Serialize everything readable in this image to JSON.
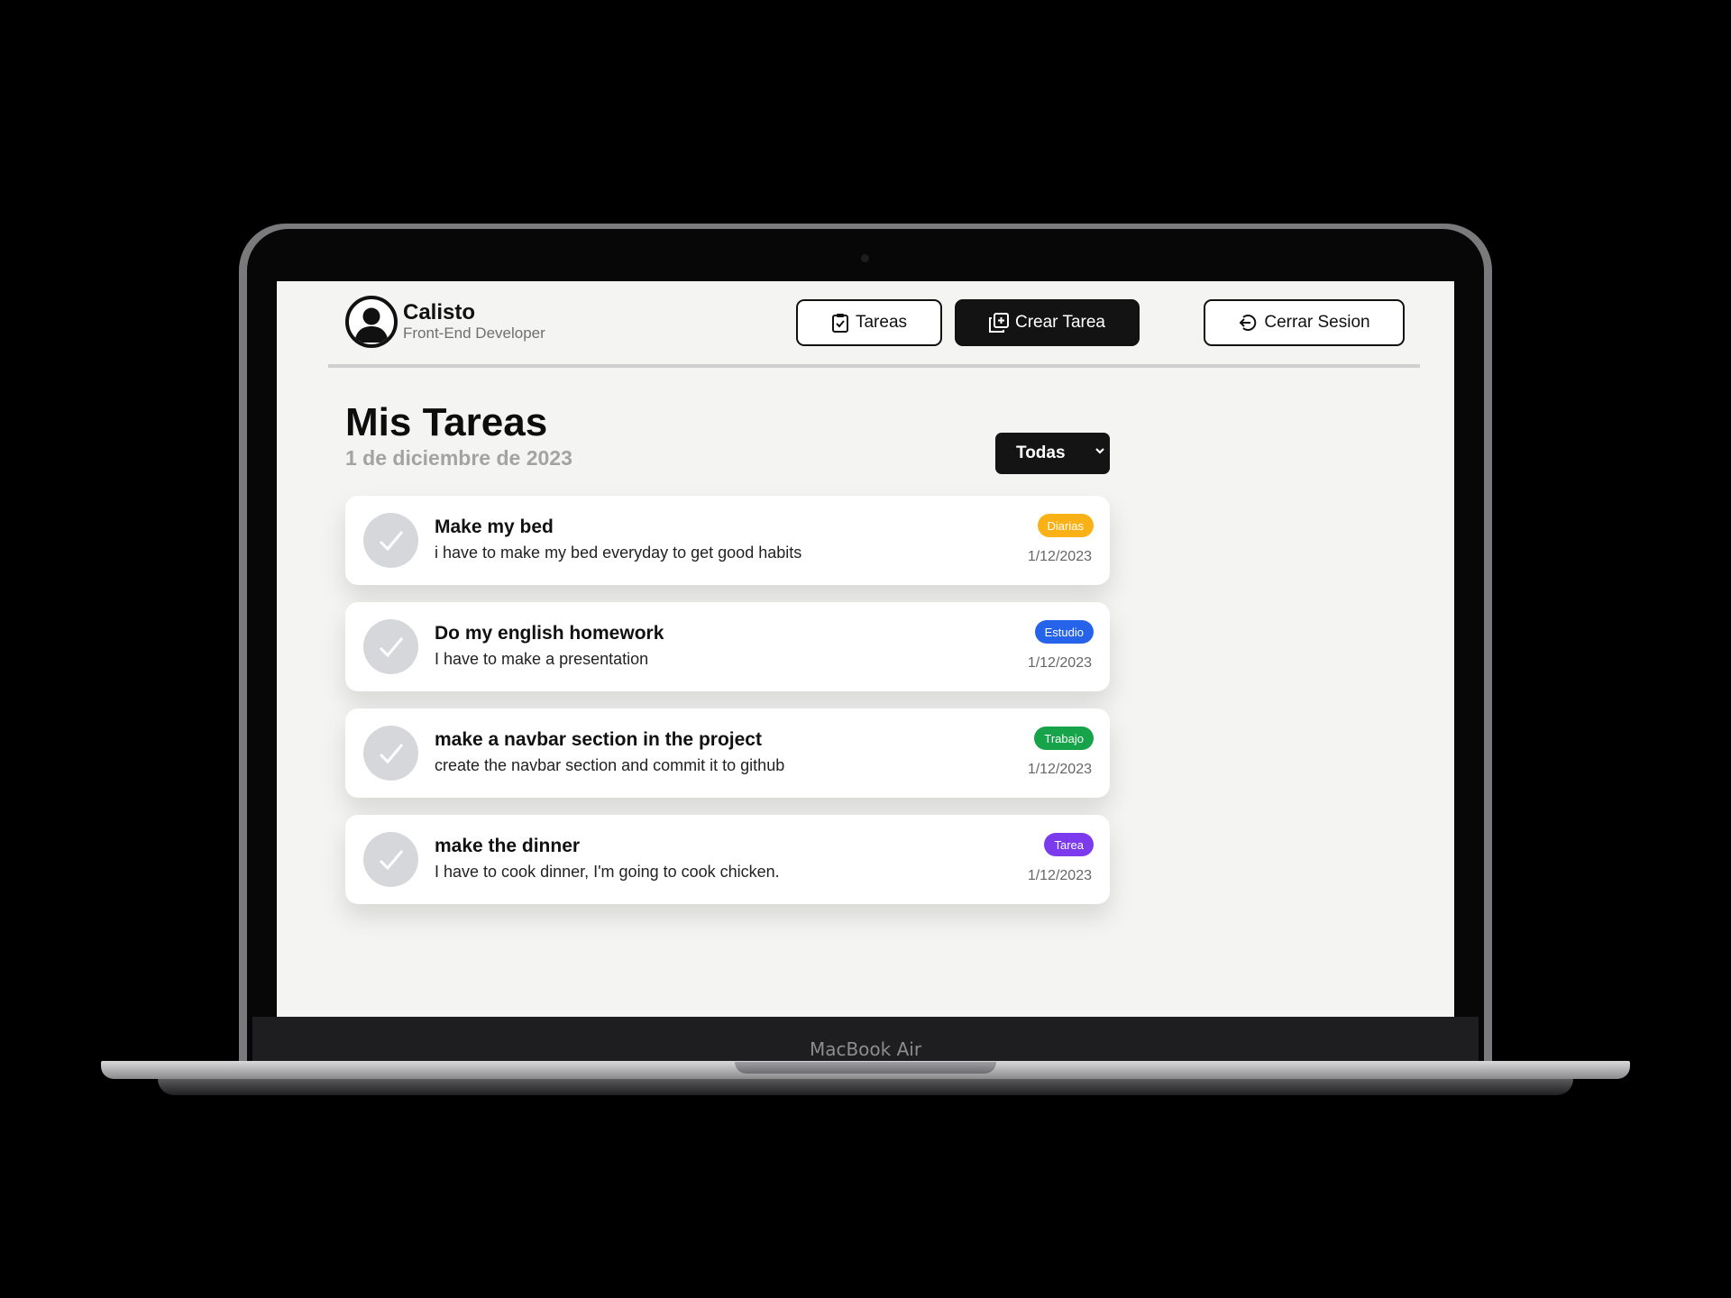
{
  "device": {
    "label": "MacBook Air"
  },
  "user": {
    "name": "Calisto",
    "role": "Front-End Developer"
  },
  "nav": {
    "tasks_label": "Tareas",
    "create_label": "Crear Tarea",
    "logout_label": "Cerrar Sesion"
  },
  "page": {
    "title": "Mis Tareas",
    "date": "1 de diciembre de 2023",
    "filter": {
      "selected": "Todas"
    }
  },
  "tasks": [
    {
      "title": "Make my bed",
      "description": "i have to make my bed everyday to get good habits",
      "category": "Diarias",
      "category_color": "#f9b116",
      "date": "1/12/2023"
    },
    {
      "title": "Do my english homework",
      "description": "I have to make a presentation",
      "category": "Estudio",
      "category_color": "#2563eb",
      "date": "1/12/2023"
    },
    {
      "title": "make a navbar section in the project",
      "description": "create the navbar section and commit it to github",
      "category": "Trabajo",
      "category_color": "#16a34a",
      "date": "1/12/2023"
    },
    {
      "title": "make the dinner",
      "description": "I have to cook dinner, I'm going to cook chicken.",
      "category": "Tarea",
      "category_color": "#7c3aed",
      "date": "1/12/2023"
    }
  ]
}
